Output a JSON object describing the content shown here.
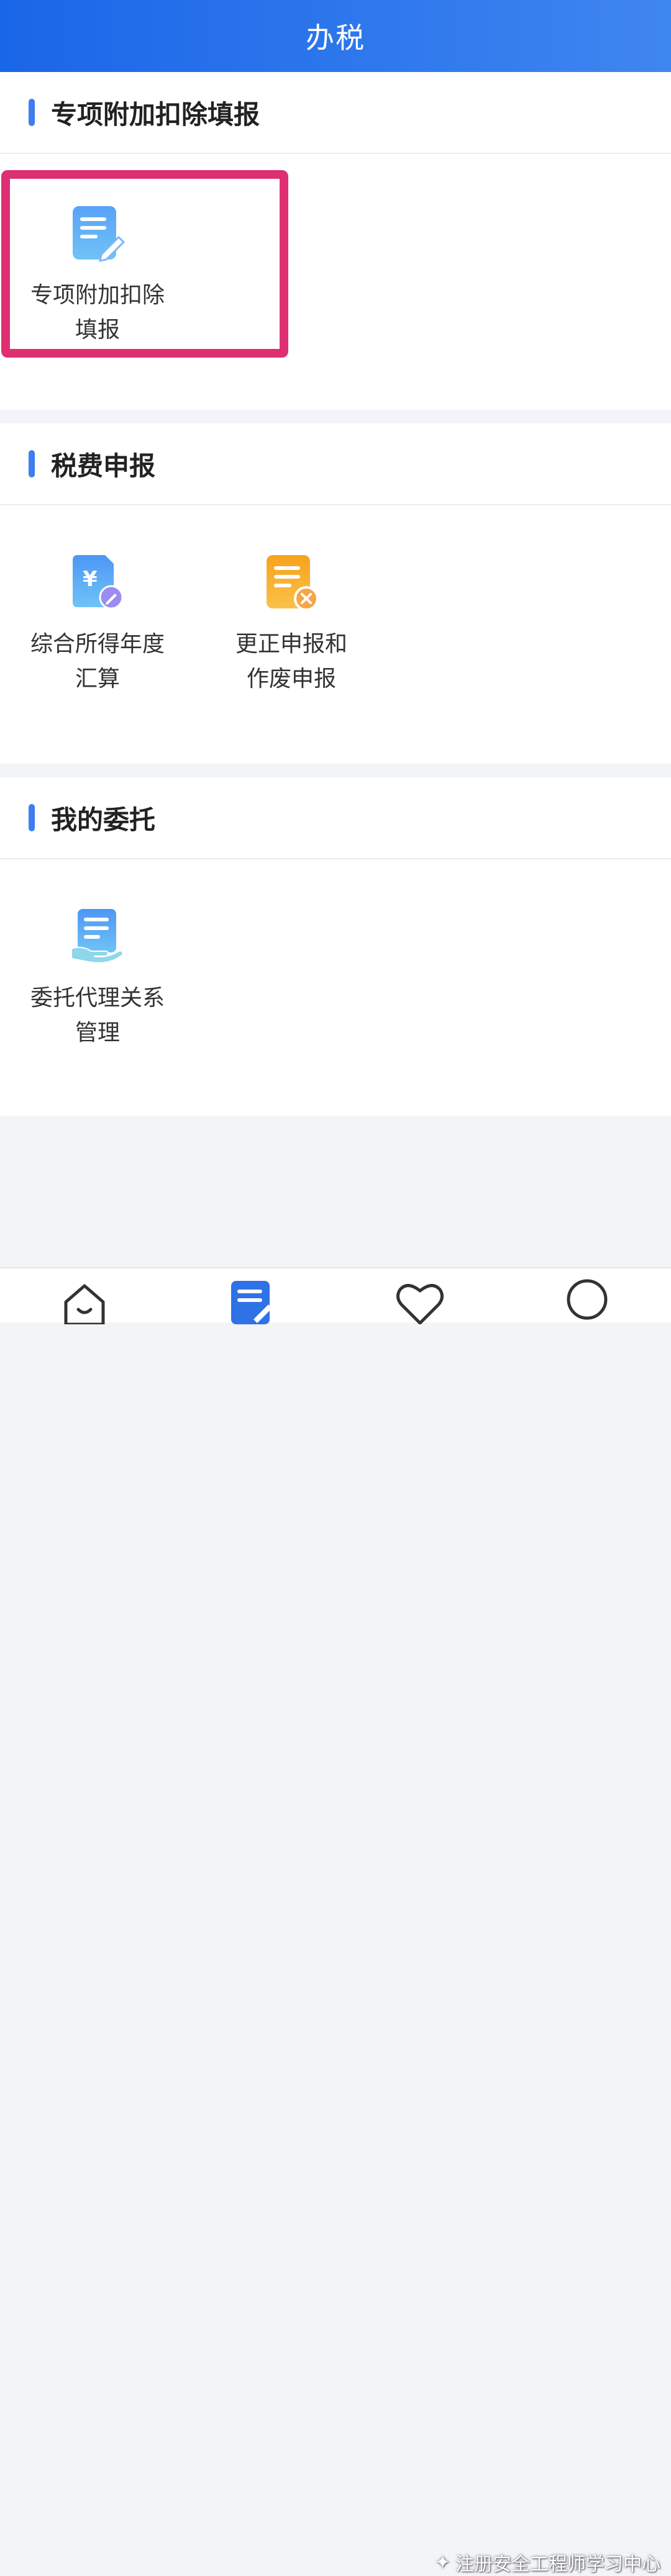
{
  "header": {
    "title": "办税"
  },
  "sections": [
    {
      "title": "专项附加扣除填报",
      "tiles": [
        {
          "label_line1": "专项附加扣除",
          "label_line2": "填报",
          "icon": "document-edit-icon"
        }
      ]
    },
    {
      "title": "税费申报",
      "tiles": [
        {
          "label_line1": "综合所得年度",
          "label_line2": "汇算",
          "icon": "yuan-document-icon"
        },
        {
          "label_line1": "更正申报和",
          "label_line2": "作废申报",
          "icon": "document-cancel-icon"
        }
      ]
    },
    {
      "title": "我的委托",
      "tiles": [
        {
          "label_line1": "委托代理关系",
          "label_line2": "管理",
          "icon": "document-hand-icon"
        }
      ]
    }
  ],
  "tabbar": {
    "items": [
      {
        "icon": "home-icon"
      },
      {
        "icon": "tax-document-icon"
      },
      {
        "icon": "heart-icon"
      },
      {
        "icon": "user-icon"
      }
    ]
  },
  "watermark": {
    "text": "注册安全工程师学习中心"
  },
  "colors": {
    "header_start": "#1a66e8",
    "header_end": "#3f86f0",
    "accent_bar": "#3d7df0",
    "highlight": "#df2f73",
    "icon_orange": "#f7a21b"
  }
}
